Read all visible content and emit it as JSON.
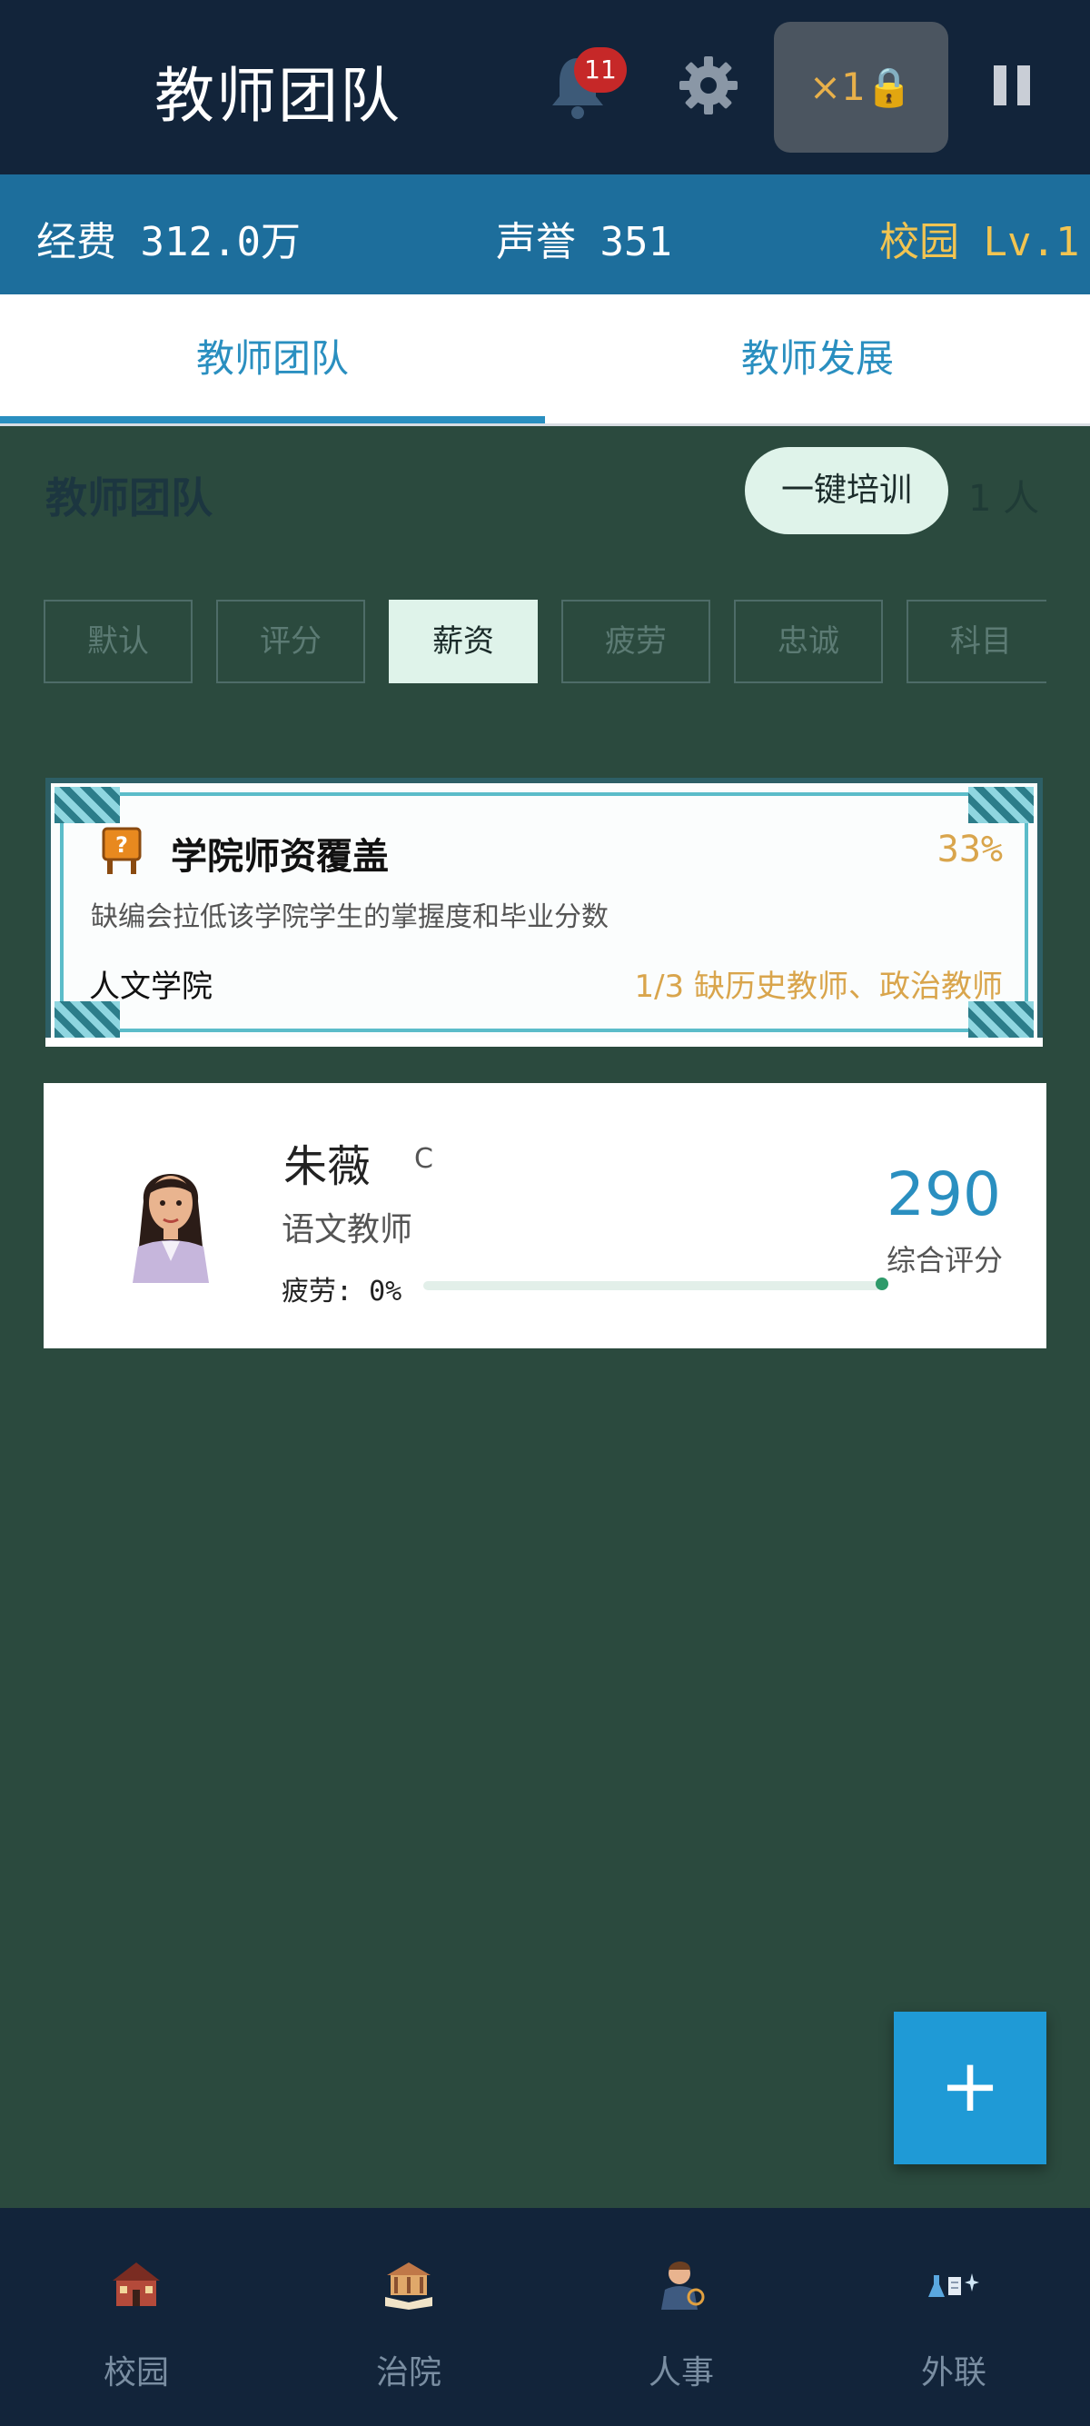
{
  "header": {
    "title": "教师团队",
    "notification_count": "11",
    "speed_label": "×1🔒"
  },
  "stats": {
    "funds": "经费 312.0万",
    "reputation": "声誉 351",
    "campus_level": "校园 Lv.1"
  },
  "tabs": [
    {
      "label": "教师团队",
      "active": true
    },
    {
      "label": "教师发展",
      "active": false
    }
  ],
  "section": {
    "title": "教师团队",
    "train_button": "一键培训",
    "count": "1 人"
  },
  "filters": [
    "默认",
    "评分",
    "薪资",
    "疲劳",
    "忠诚",
    "科目"
  ],
  "active_filter": "薪资",
  "coverage": {
    "title": "学院师资覆盖",
    "percent": "33%",
    "description": "缺编会拉低该学院学生的掌握度和毕业分数",
    "college": "人文学院",
    "missing": "1/3 缺历史教师、政治教师"
  },
  "teachers": [
    {
      "name": "朱薇",
      "grade": "C",
      "role": "语文教师",
      "fatigue": "疲劳: 0%",
      "fatigue_level": 0,
      "score": "290",
      "score_label": "综合评分"
    }
  ],
  "fab_label": "+",
  "bottom_nav": [
    {
      "label": "校园",
      "icon": "campus-icon"
    },
    {
      "label": "治院",
      "icon": "college-icon"
    },
    {
      "label": "人事",
      "icon": "personnel-icon"
    },
    {
      "label": "外联",
      "icon": "outreach-icon"
    }
  ],
  "colors": {
    "accent": "#2a8fc0",
    "gold": "#d9a54c",
    "background": "#2b4a3e",
    "topbar": "#12243a"
  }
}
